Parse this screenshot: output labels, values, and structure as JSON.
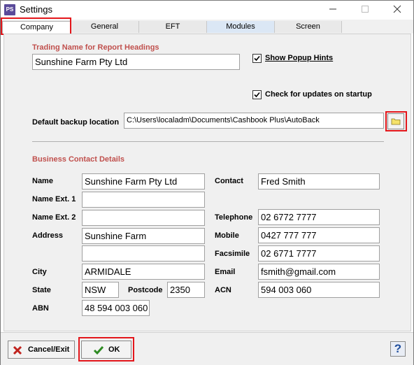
{
  "window": {
    "title": "Settings",
    "app_icon_text": "PS"
  },
  "tabs": [
    {
      "label": "Company"
    },
    {
      "label": "General"
    },
    {
      "label": "EFT"
    },
    {
      "label": "Modules"
    },
    {
      "label": "Screen"
    }
  ],
  "company": {
    "trading_name_heading": "Trading Name for Report Headings",
    "trading_name_value": "Sunshine Farm Pty Ltd",
    "show_popup_hints_label": "Show Popup Hints",
    "show_popup_hints_checked": true,
    "check_updates_label": "Check for updates on startup",
    "check_updates_checked": true,
    "backup_label": "Default backup location",
    "backup_value": "C:\\Users\\localadm\\Documents\\Cashbook Plus\\AutoBack",
    "contact_heading": "Business Contact Details",
    "labels": {
      "name": "Name",
      "name_ext1": "Name Ext. 1",
      "name_ext2": "Name Ext. 2",
      "address": "Address",
      "city": "City",
      "state": "State",
      "postcode": "Postcode",
      "abn": "ABN",
      "contact": "Contact",
      "telephone": "Telephone",
      "mobile": "Mobile",
      "facsimile": "Facsimile",
      "email": "Email",
      "acn": "ACN"
    },
    "values": {
      "name": "Sunshine Farm Pty Ltd",
      "name_ext1": "",
      "name_ext2": "",
      "address1": "Sunshine Farm",
      "address2": "",
      "city": "ARMIDALE",
      "state": "NSW",
      "postcode": "2350",
      "abn": "48 594 003 060",
      "contact": "Fred Smith",
      "telephone": "02 6772 7777",
      "mobile": "0427 777 777",
      "facsimile": "02 6771 7777",
      "email": "fsmith@gmail.com",
      "acn": "594 003 060"
    }
  },
  "buttons": {
    "cancel_label": "Cancel/Exit",
    "ok_label": "OK",
    "help_label": "?"
  },
  "colors": {
    "section_title": "#c0504d",
    "highlight": "#e3161b"
  }
}
